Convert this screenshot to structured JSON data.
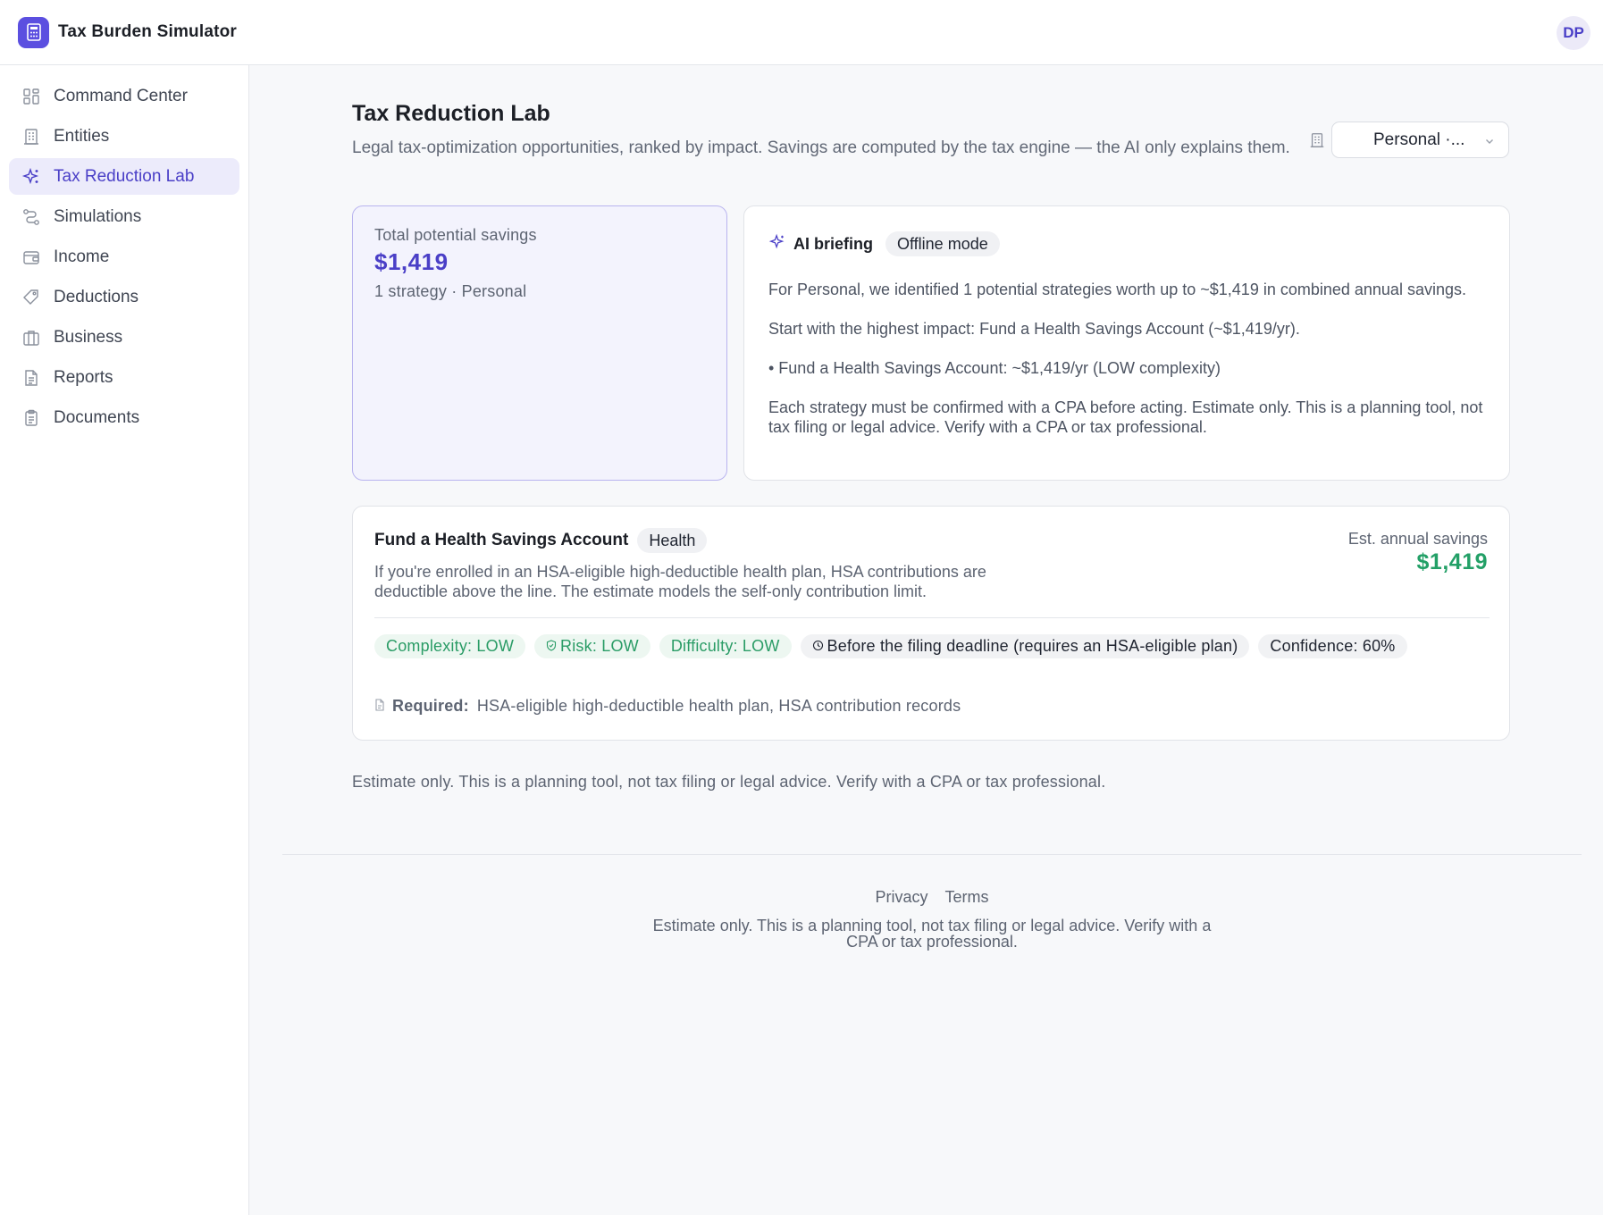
{
  "app": {
    "title": "Tax Burden Simulator",
    "user_initials": "DP"
  },
  "sidebar": {
    "items": [
      {
        "label": "Command Center",
        "icon": "dashboard-icon",
        "active": false
      },
      {
        "label": "Entities",
        "icon": "building-icon",
        "active": false
      },
      {
        "label": "Tax Reduction Lab",
        "icon": "sparkle-icon",
        "active": true
      },
      {
        "label": "Simulations",
        "icon": "route-icon",
        "active": false
      },
      {
        "label": "Income",
        "icon": "wallet-icon",
        "active": false
      },
      {
        "label": "Deductions",
        "icon": "tag-icon",
        "active": false
      },
      {
        "label": "Business",
        "icon": "briefcase-icon",
        "active": false
      },
      {
        "label": "Reports",
        "icon": "document-icon",
        "active": false
      },
      {
        "label": "Documents",
        "icon": "clipboard-icon",
        "active": false
      }
    ]
  },
  "page": {
    "title": "Tax Reduction Lab",
    "subtitle": "Legal tax-optimization opportunities, ranked by impact. Savings are computed by the tax engine — the AI only explains them.",
    "entity_select": {
      "value": "Personal ·...",
      "icon": "building-icon"
    }
  },
  "summary": {
    "label": "Total potential savings",
    "value": "$1,419",
    "meta": "1 strategy · Personal"
  },
  "ai_briefing": {
    "title": "AI briefing",
    "mode_badge": "Offline mode",
    "paragraphs": [
      "For Personal, we identified 1 potential strategies worth up to ~$1,419 in combined annual savings.",
      "Start with the highest impact: Fund a Health Savings Account (~$1,419/yr).",
      "• Fund a Health Savings Account: ~$1,419/yr (LOW complexity)",
      "Each strategy must be confirmed with a CPA before acting. Estimate only. This is a planning tool, not tax filing or legal advice. Verify with a CPA or tax professional."
    ]
  },
  "strategy": {
    "title": "Fund a Health Savings Account",
    "category": "Health",
    "description": "If you're enrolled in an HSA-eligible high-deductible health plan, HSA contributions are deductible above the line. The estimate models the self-only contribution limit.",
    "est_label": "Est. annual savings",
    "est_value": "$1,419",
    "tags": {
      "complexity": "Complexity: LOW",
      "risk": "Risk: LOW",
      "difficulty": "Difficulty: LOW",
      "deadline": "Before the filing deadline (requires an HSA-eligible plan)",
      "confidence": "Confidence: 60%"
    },
    "required_label": "Required:",
    "required_value": "HSA-eligible high-deductible health plan, HSA contribution records"
  },
  "disclaimer": "Estimate only. This is a planning tool, not tax filing or legal advice. Verify with a CPA or tax professional.",
  "footer": {
    "privacy": "Privacy",
    "terms": "Terms",
    "note": "Estimate only. This is a planning tool, not tax filing or legal advice. Verify with a CPA or tax professional."
  },
  "colors": {
    "accent": "#5b4fe0",
    "accent_text": "#4a3fc7",
    "success": "#23a067",
    "active_nav_bg": "#ecebfb"
  }
}
